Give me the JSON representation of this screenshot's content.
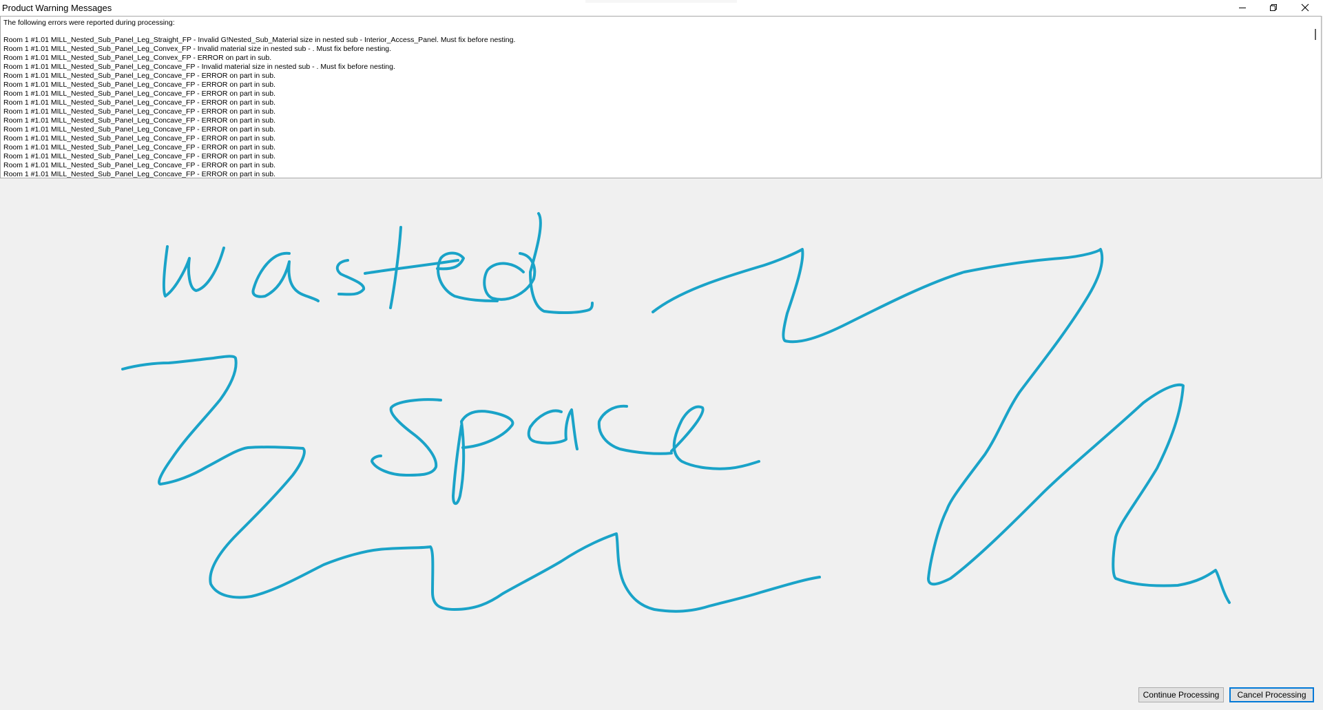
{
  "window": {
    "title": "Product Warning Messages",
    "controls": {
      "minimize_icon": "minimize-icon",
      "restore_icon": "restore-icon",
      "close_icon": "close-icon"
    }
  },
  "messages": {
    "header": "The following errors were reported during processing:",
    "lines": [
      "Room 1 #1.01 MILL_Nested_Sub_Panel_Leg_Straight_FP - Invalid G!Nested_Sub_Material size in nested sub - Interior_Access_Panel.  Must fix before nesting.",
      "Room 1 #1.01 MILL_Nested_Sub_Panel_Leg_Convex_FP - Invalid material size in nested sub - .  Must fix before nesting.",
      "Room 1 #1.01 MILL_Nested_Sub_Panel_Leg_Convex_FP - ERROR on part in  sub.",
      "Room 1 #1.01 MILL_Nested_Sub_Panel_Leg_Concave_FP - Invalid material size in nested sub - .  Must fix before nesting.",
      "Room 1 #1.01 MILL_Nested_Sub_Panel_Leg_Concave_FP - ERROR on part in  sub.",
      "Room 1 #1.01 MILL_Nested_Sub_Panel_Leg_Concave_FP - ERROR on part in  sub.",
      "Room 1 #1.01 MILL_Nested_Sub_Panel_Leg_Concave_FP - ERROR on part in  sub.",
      "Room 1 #1.01 MILL_Nested_Sub_Panel_Leg_Concave_FP - ERROR on part in  sub.",
      "Room 1 #1.01 MILL_Nested_Sub_Panel_Leg_Concave_FP - ERROR on part in  sub.",
      "Room 1 #1.01 MILL_Nested_Sub_Panel_Leg_Concave_FP - ERROR on part in  sub.",
      "Room 1 #1.01 MILL_Nested_Sub_Panel_Leg_Concave_FP - ERROR on part in  sub.",
      "Room 1 #1.01 MILL_Nested_Sub_Panel_Leg_Concave_FP - ERROR on part in  sub.",
      "Room 1 #1.01 MILL_Nested_Sub_Panel_Leg_Concave_FP - ERROR on part in  sub.",
      "Room 1 #1.01 MILL_Nested_Sub_Panel_Leg_Concave_FP - ERROR on part in  sub.",
      "Room 1 #1.01 MILL_Nested_Sub_Panel_Leg_Concave_FP - ERROR on part in  sub.",
      "Room 1 #1.01 MILL_Nested_Sub_Panel_Leg_Concave_FP - ERROR on part in  sub."
    ]
  },
  "annotation": {
    "handwriting": "wasted space",
    "ink_color": "#1aa3c8"
  },
  "buttons": {
    "continue_label": "Continue Processing",
    "cancel_label": "Cancel Processing"
  }
}
